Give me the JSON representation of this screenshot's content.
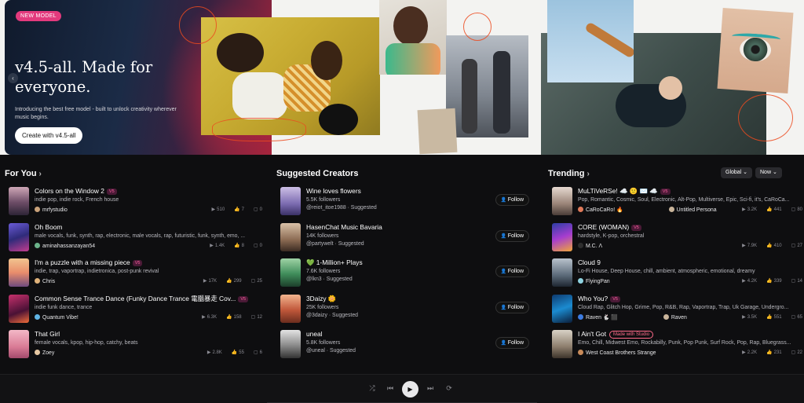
{
  "hero": {
    "badge": "NEW MODEL",
    "title": "v4.5-all. Made for everyone.",
    "subtitle": "Introducing the best free model - built to unlock creativity wherever music begins.",
    "cta": "Create with v4.5-all",
    "prev_icon": "‹"
  },
  "for_you": {
    "title": "For You",
    "chevron": "›",
    "items": [
      {
        "title": "Colors on the Window 2",
        "badge": "V5",
        "tags": "indie pop, indie rock, French house",
        "author": "mrfystudio",
        "plays": "510",
        "likes": "7",
        "comments": "0",
        "thumb": "linear-gradient(180deg,#cfa7b6,#6c4c66 55%,#2d2436)",
        "dot": "#c9a27a"
      },
      {
        "title": "Oh Boom",
        "badge": "",
        "tags": "male vocals, funk, synth, rap, electronic, male vocals, rap, futuristic, funk, synth, emo, ...",
        "author": "aminahassanzayan54",
        "plays": "1.4K",
        "likes": "8",
        "comments": "0",
        "thumb": "linear-gradient(160deg,#6a5bd6,#2f2b7a 50%,#c23c8f)",
        "dot": "#6bb38a"
      },
      {
        "title": "I'm a puzzle with a missing piece",
        "badge": "V5",
        "tags": "indie, trap, vaportrap, indietronica, post-punk revival",
        "author": "Chris",
        "plays": "17K",
        "likes": "299",
        "comments": "25",
        "thumb": "linear-gradient(180deg,#f1c48f,#e98d6b 50%,#6f4b7e)",
        "dot": "#e0b27a"
      },
      {
        "title": "Common Sense Trance Dance (Funky Dance Trance 電腦暴走 Cov...",
        "badge": "V5",
        "tags": "indie funk dance, trance",
        "author": "Quantum Vibe!",
        "plays": "6.3K",
        "likes": "158",
        "comments": "12",
        "thumb": "linear-gradient(160deg,#c6316d,#4a1135 60%,#f06d3a)",
        "dot": "#5fb5e6"
      },
      {
        "title": "That Girl",
        "badge": "",
        "tags": "female vocals, kpop, hip-hop, catchy, beats",
        "author": "Zoey",
        "plays": "2.8K",
        "likes": "55",
        "comments": "6",
        "thumb": "linear-gradient(180deg,#f3b8c7,#d97b95 60%,#a34a6c)",
        "dot": "#e7c8a3"
      }
    ]
  },
  "creators": {
    "title": "Suggested Creators",
    "follow_label": "Follow",
    "items": [
      {
        "name": "Wine loves flowers",
        "followers": "5.5K followers",
        "handle": "@reiot_itoe1988 · Suggested",
        "thumb": "linear-gradient(180deg,#cdbfe6,#7b6bb0 60%,#3a3166)"
      },
      {
        "name": "HasenChat Music Bavaria",
        "followers": "14K followers",
        "handle": "@partywelt · Suggested",
        "thumb": "linear-gradient(180deg,#d9c1a8,#8a6a52 60%,#3b2b22)"
      },
      {
        "name": "💚 1-Million+ Plays",
        "followers": "7.6K followers",
        "handle": "@lkn3 · Suggested",
        "thumb": "linear-gradient(180deg,#9fd3a5,#3f8d5a 55%,#1c3e2a)"
      },
      {
        "name": "3Daizy 🌼",
        "followers": "25K followers",
        "handle": "@3daizy · Suggested",
        "thumb": "linear-gradient(180deg,#f2b48e,#c0573a 55%,#6b2d1e)"
      },
      {
        "name": "uneal",
        "followers": "5.8K followers",
        "handle": "@uneal · Suggested",
        "thumb": "linear-gradient(180deg,#e4e4e4,#8a8a8a 55%,#333)"
      }
    ]
  },
  "trending": {
    "title": "Trending",
    "chevron": "›",
    "filter_region": "Global ⌄",
    "filter_time": "Now ⌄",
    "items": [
      {
        "title": "MuLTiVeRSe! ☁️ 🙂 ✉️ ☁️",
        "badge": "V5",
        "tags": "Pop, Romantic, Cosmic, Soul, Electronic, Alt-Pop, Multiverse, Epic, Sci-fi, it's, CaRoCa...",
        "author": "CaRoCaRo! 🔥",
        "author2": "Untitled Persona",
        "plays": "3.2K",
        "likes": "441",
        "comments": "80",
        "thumb": "linear-gradient(180deg,#e6d9d0,#9a8478 60%,#4a3d38)",
        "dot": "#e07a5a"
      },
      {
        "title": "CORE (WOMAN)",
        "badge": "V5",
        "tags": "hardstyle, K-pop, orchestral",
        "author": "M.C. Λ",
        "author2": "",
        "plays": "7.9K",
        "likes": "410",
        "comments": "27",
        "thumb": "linear-gradient(160deg,#2d3ea6,#a63dcf 50%,#f0a53a)",
        "dot": "#2e2e2e"
      },
      {
        "title": "Cloud 9",
        "badge": "",
        "tags": "Lo-Fi House, Deep House, chill, ambient, atmospheric, emotional, dreamy",
        "author": "FlyingPan",
        "author2": "",
        "plays": "4.2K",
        "likes": "339",
        "comments": "14",
        "thumb": "linear-gradient(180deg,#b9c2cc,#5b6a79 60%,#1e2630)",
        "dot": "#8fd3e0"
      },
      {
        "title": "Who You?",
        "badge": "V5",
        "tags": "Cloud Rap, Glitch Hop, Grime, Pop, R&B, Rap, Vaportrap, Trap, Uk Garage, Undergro...",
        "author": "Raven 🐇 ⬛",
        "author2": "Raven",
        "plays": "3.5K",
        "likes": "551",
        "comments": "65",
        "thumb": "linear-gradient(160deg,#0e3a6e,#1b8bd0 50%,#0b1d3a)",
        "dot": "#3d7be0"
      },
      {
        "title": "I Ain't Got",
        "badge": "Made with Studio",
        "tags": "Emo, Chill, Midwest Emo, Rockabilly, Punk, Pop Punk, Surf Rock, Pop, Rap, Bluegrass...",
        "author": "West Coast Brothers Strange",
        "author2": "",
        "plays": "2.2K",
        "likes": "231",
        "comments": "22",
        "thumb": "linear-gradient(180deg,#d8d2c6,#8c7d6c 60%,#3d342b)",
        "dot": "#c88b5a"
      }
    ]
  },
  "player": {
    "shuffle_icon": "⤮",
    "prev_icon": "⏮",
    "play_icon": "▶",
    "next_icon": "⏭",
    "repeat_icon": "⟳"
  },
  "stat_icons": {
    "plays": "▶",
    "likes": "👍",
    "comments": "▢"
  }
}
